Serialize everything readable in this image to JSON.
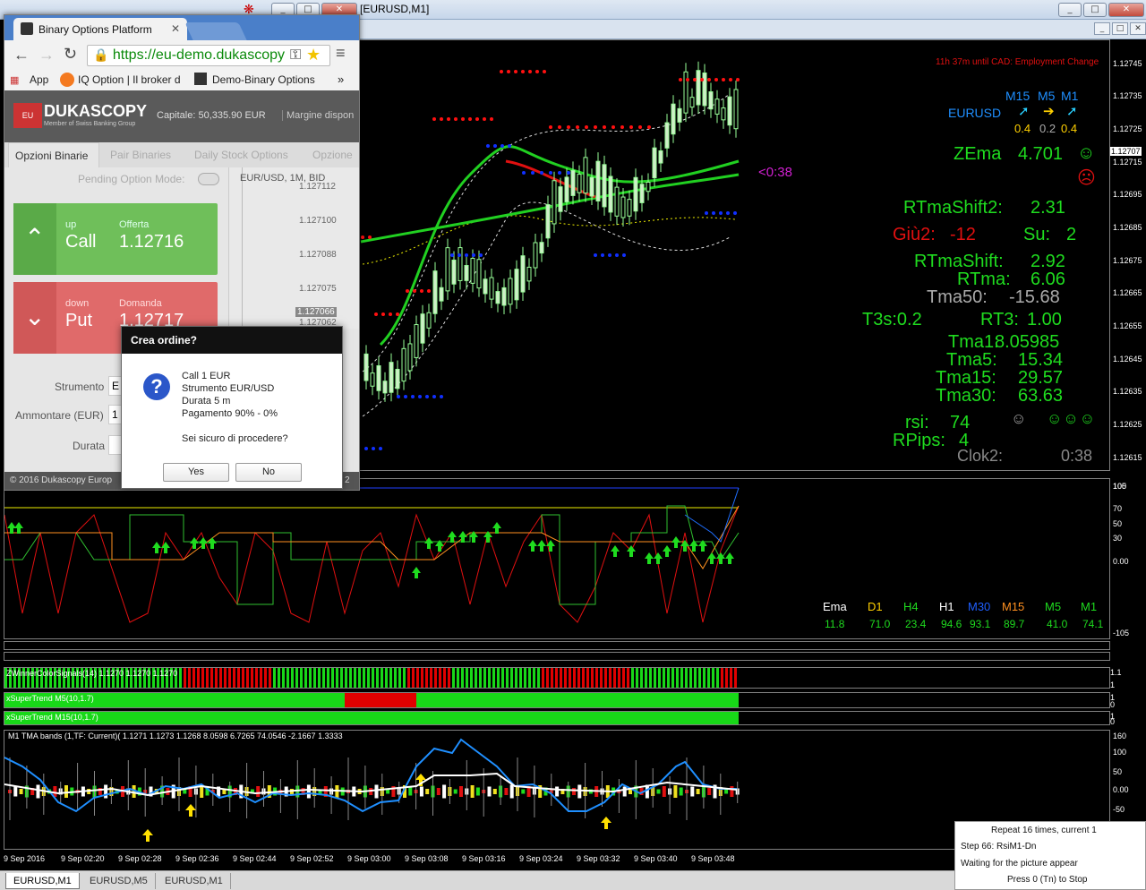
{
  "terminal": {
    "title_fragment": "[EURUSD,M1]",
    "window_buttons": {
      "min": "_",
      "max": "□",
      "close": "✕"
    },
    "main_chart": {
      "event_note": "11h 37m until CAD: Employment Change",
      "countdown": "<0:38",
      "current_price": "1.12707",
      "price_ticks": [
        "1.12745",
        "1.12735",
        "1.12725",
        "1.12715",
        "1.12707",
        "1.12695",
        "1.12685",
        "1.12675",
        "1.12665",
        "1.12655",
        "1.12645",
        "1.12635",
        "1.12625",
        "1.12615"
      ],
      "tf_header": {
        "symbol": "EURUSD",
        "tfs": [
          "M15",
          "M5",
          "M1"
        ],
        "vals": [
          "0.4",
          "0.2",
          "0.4"
        ]
      },
      "stats": {
        "zema_label": "ZEma",
        "zema_value": "4.701",
        "rtmashift2_label": "RTmaShift2:",
        "rtmashift2_value": "2.31",
        "giu2_label": "Giù2:",
        "giu2_value": "-12",
        "su_label": "Su:",
        "su_value": "2",
        "rtmashift_label": "RTmaShift:",
        "rtmashift_value": "2.92",
        "rtma_label": "RTma:",
        "rtma_value": "6.06",
        "tma50_label": "Tma50:",
        "tma50_value": "-15.68",
        "t3s": "T3s:0.2",
        "rt3_label": "RT3:",
        "rt3_value": "1.00",
        "tma1_label": "Tma1:",
        "tma1_value": "8.05985",
        "tma5_label": "Tma5:",
        "tma5_value": "15.34",
        "tma15_label": "Tma15:",
        "tma15_value": "29.57",
        "tma30_label": "Tma30:",
        "tma30_value": "63.63",
        "rsi_label": "rsi:",
        "rsi_value": "74",
        "rpips_label": "RPips:",
        "rpips_value": "4",
        "clok2_label": "Clok2:",
        "clok2_value": "0:38"
      }
    },
    "osc_pane": {
      "ticks": [
        "100",
        "105",
        "70",
        "50",
        "30",
        "0.00",
        "-105"
      ],
      "tf_table": {
        "headers": [
          "Ema",
          "D1",
          "H4",
          "H1",
          "M30",
          "M15",
          "M5",
          "M1"
        ],
        "values": [
          "11.8",
          "71.0",
          "23.4",
          "94.6",
          "93.1",
          "89.7",
          "41.0",
          "74.1"
        ]
      }
    },
    "signal_panes": [
      {
        "label": "ZWinnerColorSignals(14) 1.1270 1.1270 1.1270",
        "ticks": [
          "1.1",
          "1"
        ]
      },
      {
        "label": "xSuperTrend M5(10,1.7)",
        "ticks": [
          "1",
          "0"
        ]
      },
      {
        "label": "xSuperTrend M15(10,1.7)",
        "ticks": [
          "1",
          "0"
        ]
      }
    ],
    "tma_pane": {
      "label": "M1 TMA bands (1,TF: Current)( 1.1271 1.1273 1.1268 8.0598 6.7265 74.0546 -2.1667 1.3333",
      "ticks": [
        "160",
        "100",
        "50",
        "0.00",
        "-50"
      ]
    },
    "time_axis": [
      "9 Sep 2016",
      "9 Sep 02:20",
      "9 Sep 02:28",
      "9 Sep 02:36",
      "9 Sep 02:44",
      "9 Sep 02:52",
      "9 Sep 03:00",
      "9 Sep 03:08",
      "9 Sep 03:16",
      "9 Sep 03:24",
      "9 Sep 03:32",
      "9 Sep 03:40",
      "9 Sep 03:48"
    ],
    "chart_tabs": [
      "EURUSD,M1",
      "EURUSD,M5",
      "EURUSD,M1"
    ],
    "repeat_box": [
      "Repeat 16 times, current 1",
      "Step 66: RsiM1-Dn",
      "Waiting for the picture appear",
      "Press 0 (Tn) to Stop"
    ]
  },
  "chrome": {
    "tab_title": "Binary Options Platform",
    "url": "https://eu-demo.dukascopy",
    "bookmarks": [
      "App",
      "IQ Option | Il broker d",
      "Demo-Binary Options"
    ],
    "bookmarks_more": "»",
    "dukascopy": {
      "logo": "DUKASCOPY",
      "logo_sub": "Member of Swiss Banking Group",
      "capital": "Capitale: 50,335.90 EUR",
      "margin": "Margine dispon",
      "tabs": [
        "Opzioni Binarie",
        "Pair Binaries",
        "Daily Stock Options",
        "Opzione"
      ],
      "pending_mode": "Pending Option Mode:",
      "chart_title": "EUR/USD, 1M, BID",
      "price_ticks": [
        "1.127112",
        "1.127100",
        "1.127088",
        "1.127075",
        "1.127066",
        "1.127062"
      ],
      "call": {
        "dir": "up",
        "label": "Call",
        "offer_label": "Offerta",
        "price": "1.12716"
      },
      "put": {
        "dir": "down",
        "label": "Put",
        "bid_label": "Domanda",
        "price": "1.12717"
      },
      "fields": [
        "Strumento",
        "Ammontare (EUR)",
        "Durata"
      ],
      "field_vals": [
        "E",
        "1",
        ""
      ],
      "footer": "© 2016 Dukascopy Europ",
      "footer_right": "2"
    },
    "dialog": {
      "title": "Crea ordine?",
      "lines": [
        "Call 1 EUR",
        "Strumento EUR/USD",
        "Durata 5 m",
        "Pagamento 90% - 0%"
      ],
      "question": "Sei sicuro di procedere?",
      "yes": "Yes",
      "no": "No"
    }
  }
}
